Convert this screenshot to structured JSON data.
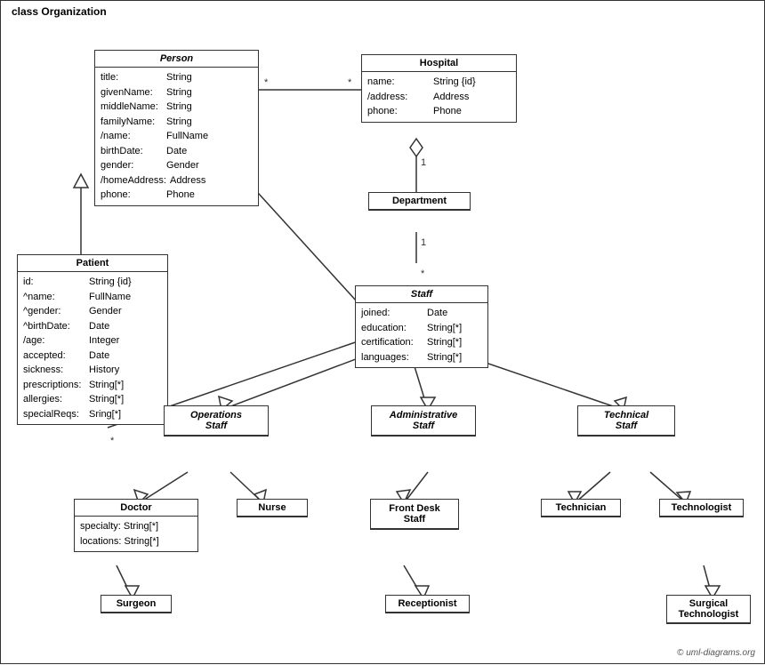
{
  "diagram": {
    "title": "class Organization",
    "classes": {
      "person": {
        "name": "Person",
        "italic": true,
        "attrs": [
          {
            "name": "title:",
            "type": "String"
          },
          {
            "name": "givenName:",
            "type": "String"
          },
          {
            "name": "middleName:",
            "type": "String"
          },
          {
            "name": "familyName:",
            "type": "String"
          },
          {
            "name": "/name:",
            "type": "FullName"
          },
          {
            "name": "birthDate:",
            "type": "Date"
          },
          {
            "name": "gender:",
            "type": "Gender"
          },
          {
            "name": "/homeAddress:",
            "type": "Address"
          },
          {
            "name": "phone:",
            "type": "Phone"
          }
        ]
      },
      "hospital": {
        "name": "Hospital",
        "italic": false,
        "attrs": [
          {
            "name": "name:",
            "type": "String {id}"
          },
          {
            "name": "/address:",
            "type": "Address"
          },
          {
            "name": "phone:",
            "type": "Phone"
          }
        ]
      },
      "patient": {
        "name": "Patient",
        "italic": false,
        "attrs": [
          {
            "name": "id:",
            "type": "String {id}"
          },
          {
            "name": "^name:",
            "type": "FullName"
          },
          {
            "name": "^gender:",
            "type": "Gender"
          },
          {
            "name": "^birthDate:",
            "type": "Date"
          },
          {
            "name": "/age:",
            "type": "Integer"
          },
          {
            "name": "accepted:",
            "type": "Date"
          },
          {
            "name": "sickness:",
            "type": "History"
          },
          {
            "name": "prescriptions:",
            "type": "String[*]"
          },
          {
            "name": "allergies:",
            "type": "String[*]"
          },
          {
            "name": "specialReqs:",
            "type": "Sring[*]"
          }
        ]
      },
      "department": {
        "name": "Department",
        "italic": false,
        "attrs": []
      },
      "staff": {
        "name": "Staff",
        "italic": true,
        "attrs": [
          {
            "name": "joined:",
            "type": "Date"
          },
          {
            "name": "education:",
            "type": "String[*]"
          },
          {
            "name": "certification:",
            "type": "String[*]"
          },
          {
            "name": "languages:",
            "type": "String[*]"
          }
        ]
      },
      "operationsStaff": {
        "name": "Operations Staff",
        "italic": true
      },
      "administrativeStaff": {
        "name": "Administrative Staff",
        "italic": true
      },
      "technicalStaff": {
        "name": "Technical Staff",
        "italic": true
      },
      "doctor": {
        "name": "Doctor",
        "italic": false,
        "attrs": [
          {
            "name": "specialty:",
            "type": "String[*]"
          },
          {
            "name": "locations:",
            "type": "String[*]"
          }
        ]
      },
      "nurse": {
        "name": "Nurse",
        "italic": false,
        "attrs": []
      },
      "frontDeskStaff": {
        "name": "Front Desk Staff",
        "italic": false,
        "attrs": []
      },
      "technician": {
        "name": "Technician",
        "italic": false,
        "attrs": []
      },
      "technologist": {
        "name": "Technologist",
        "italic": false,
        "attrs": []
      },
      "surgeon": {
        "name": "Surgeon",
        "italic": false,
        "attrs": []
      },
      "receptionist": {
        "name": "Receptionist",
        "italic": false,
        "attrs": []
      },
      "surgicalTechnologist": {
        "name": "Surgical Technologist",
        "italic": false,
        "attrs": []
      }
    },
    "copyright": "© uml-diagrams.org"
  }
}
